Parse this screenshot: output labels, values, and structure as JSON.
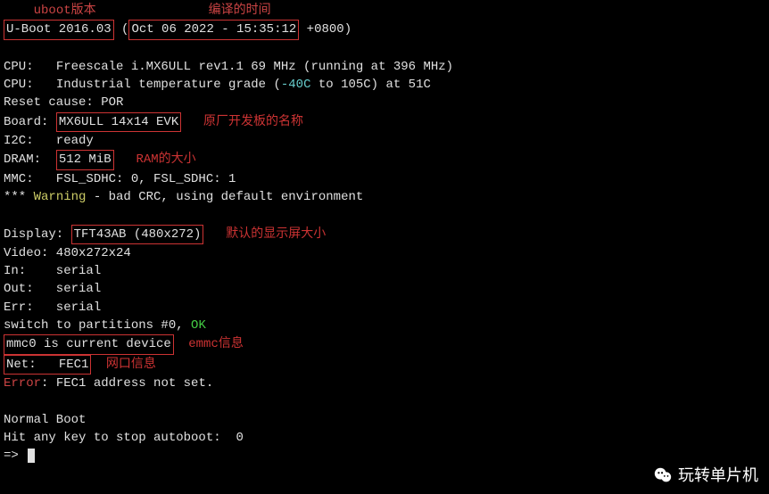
{
  "annotations": {
    "uboot_version": "uboot版本",
    "compile_time": "编译的时间",
    "board_name": "原厂开发板的名称",
    "ram_size": "RAM的大小",
    "display": "默认的显示屏大小",
    "emmc": "emmc信息",
    "net": "网口信息"
  },
  "uboot": {
    "version": "U-Boot 2016.03",
    "date": "Oct 06 2022 - 15:35:12",
    "tz": " +0800)"
  },
  "cpu1": {
    "label": "CPU:   ",
    "text": "Freescale i.MX6ULL rev1.1 69 MHz (running at 396 MHz)"
  },
  "cpu2": {
    "label": "CPU:   ",
    "text1": "Industrial temperature grade (",
    "temp": "-40C",
    "text2": " to 105C) at 51C"
  },
  "reset": "Reset cause: POR",
  "board": {
    "label": "Board: ",
    "value": "MX6ULL 14x14 EVK"
  },
  "i2c": "I2C:   ready",
  "dram": {
    "label": "DRAM:  ",
    "value": "512 MiB"
  },
  "mmc": "MMC:   FSL_SDHC: 0, FSL_SDHC: 1",
  "warn": {
    "stars": "*** ",
    "word": "Warning",
    "rest": " - bad CRC, using default environment"
  },
  "display": {
    "label": "Display: ",
    "value": "TFT43AB (480x272)"
  },
  "video": "Video: 480x272x24",
  "in_line": "In:    serial",
  "out_line": "Out:   serial",
  "err_line": "Err:   serial",
  "switch": {
    "text": "switch to partitions #0, ",
    "ok": "OK"
  },
  "mmc0": "mmc0 is current device",
  "net": {
    "label": "Net:   ",
    "value": "FEC1"
  },
  "error": {
    "label": "Error",
    "text": ": FEC1 address not set."
  },
  "normal": "Normal Boot",
  "autoboot": "Hit any key to stop autoboot:  0",
  "prompt": "=> ",
  "watermark": "玩转单片机"
}
